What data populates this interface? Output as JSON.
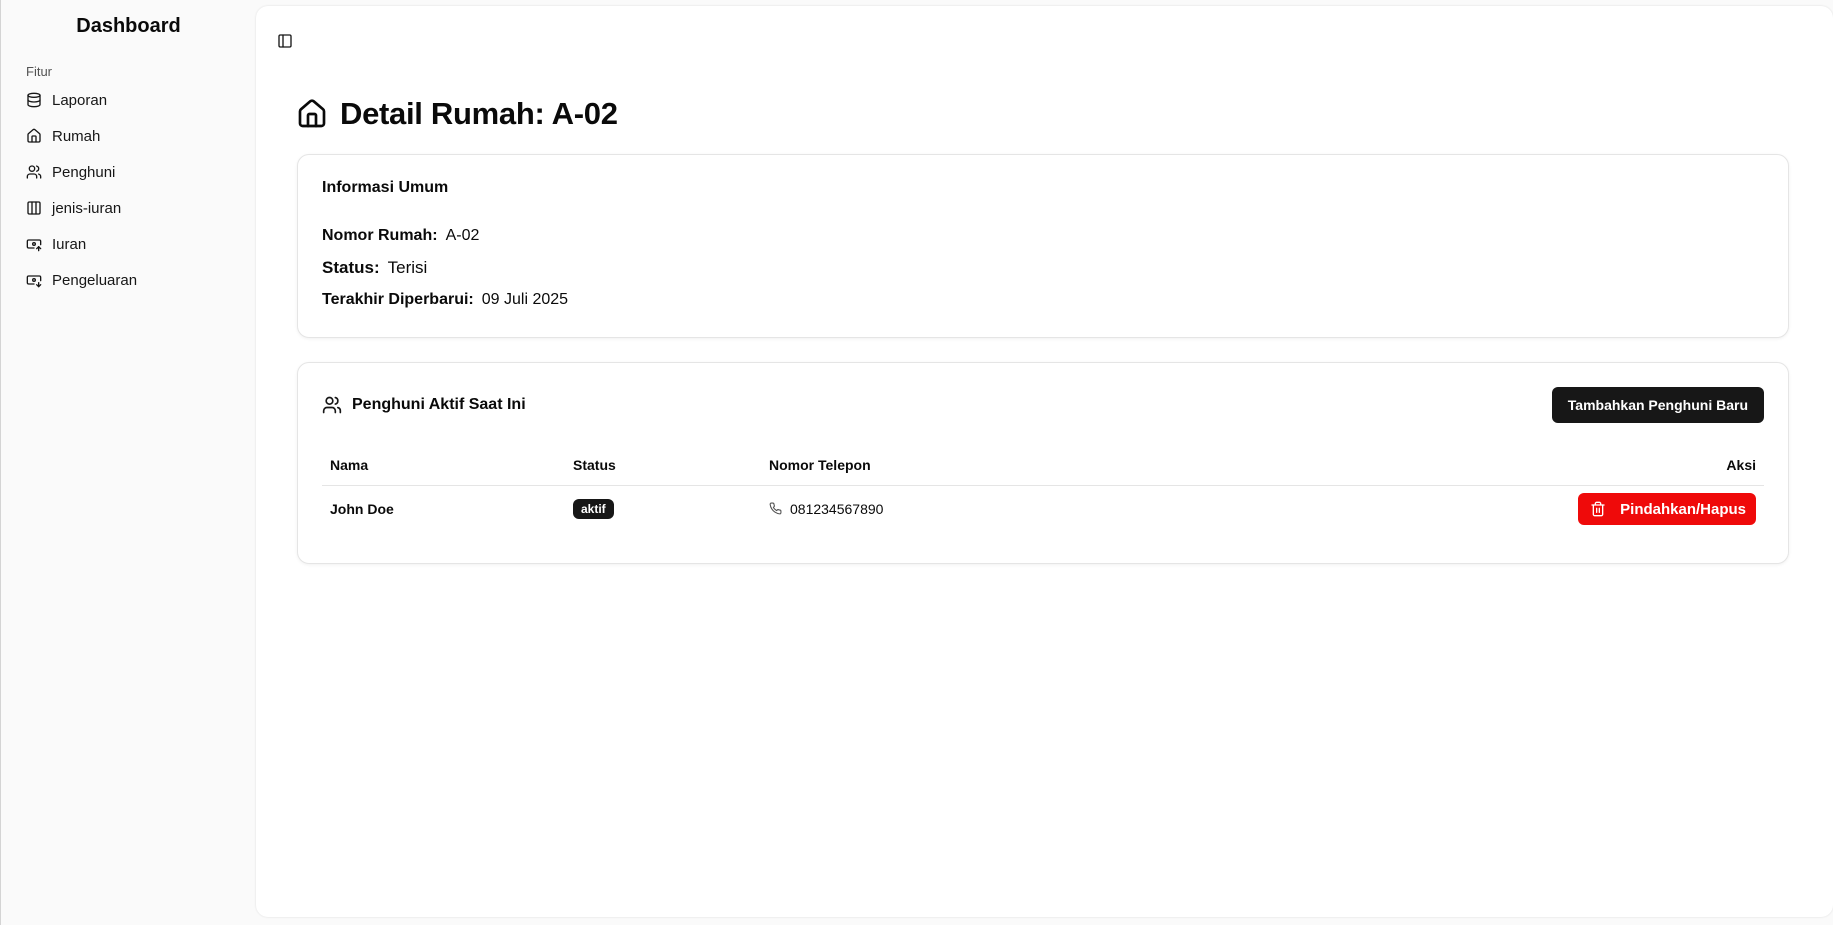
{
  "sidebar": {
    "title": "Dashboard",
    "group_label": "Fitur",
    "items": [
      {
        "label": "Laporan",
        "icon": "database-icon"
      },
      {
        "label": "Rumah",
        "icon": "home-icon"
      },
      {
        "label": "Penghuni",
        "icon": "users-icon"
      },
      {
        "label": "jenis-iuran",
        "icon": "table-icon"
      },
      {
        "label": "Iuran",
        "icon": "banknote-icon"
      },
      {
        "label": "Pengeluaran",
        "icon": "banknote-out-icon"
      }
    ]
  },
  "header": {
    "title": "Detail Rumah: A-02",
    "icon": "home-icon"
  },
  "info_card": {
    "title": "Informasi Umum",
    "rows": [
      {
        "key": "Nomor Rumah:",
        "value": "A-02"
      },
      {
        "key": "Status:",
        "value": "Terisi"
      },
      {
        "key": "Terakhir Diperbarui:",
        "value": "09 Juli 2025"
      }
    ]
  },
  "residents_card": {
    "title": "Penghuni Aktif Saat Ini",
    "add_button": "Tambahkan Penghuni Baru",
    "columns": [
      "Nama",
      "Status",
      "Nomor Telepon",
      "Aksi"
    ],
    "rows": [
      {
        "name": "John Doe",
        "status": "aktif",
        "phone": "081234567890",
        "action": "Pindahkan/Hapus"
      }
    ]
  },
  "colors": {
    "primary_dark": "#171717",
    "danger": "#ef0a0a"
  }
}
